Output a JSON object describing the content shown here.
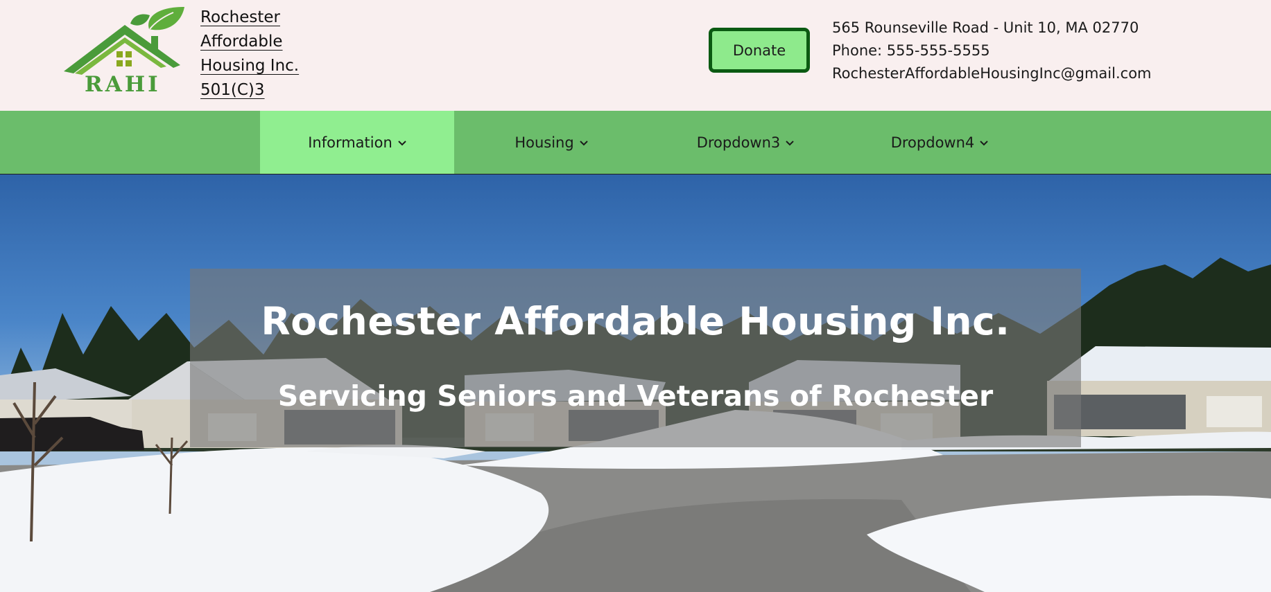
{
  "header": {
    "logo_text": "RAHI",
    "org_name_lines": [
      "Rochester",
      "Affordable",
      "Housing Inc.",
      "501(C)3"
    ],
    "donate_label": "Donate",
    "contact": {
      "address": "565 Rounseville Road - Unit 10, MA 02770",
      "phone": "Phone: 555-555-5555",
      "email": "RochesterAffordableHousingInc@gmail.com"
    }
  },
  "nav": {
    "items": [
      {
        "label": "Information",
        "active": true
      },
      {
        "label": "Housing",
        "active": false
      },
      {
        "label": "Dropdown3",
        "active": false
      },
      {
        "label": "Dropdown4",
        "active": false
      }
    ],
    "icon": "chevron-down-icon"
  },
  "hero": {
    "title": "Rochester Affordable Housing Inc.",
    "subtitle": "Servicing Seniors and Veterans of Rochester"
  },
  "colors": {
    "header_bg": "#f9efef",
    "nav_bg": "#6bbd6b",
    "nav_active_bg": "#90ee90",
    "donate_bg": "#8eea8c",
    "donate_border": "#0b5a12",
    "logo_green": "#4a9b3a"
  }
}
